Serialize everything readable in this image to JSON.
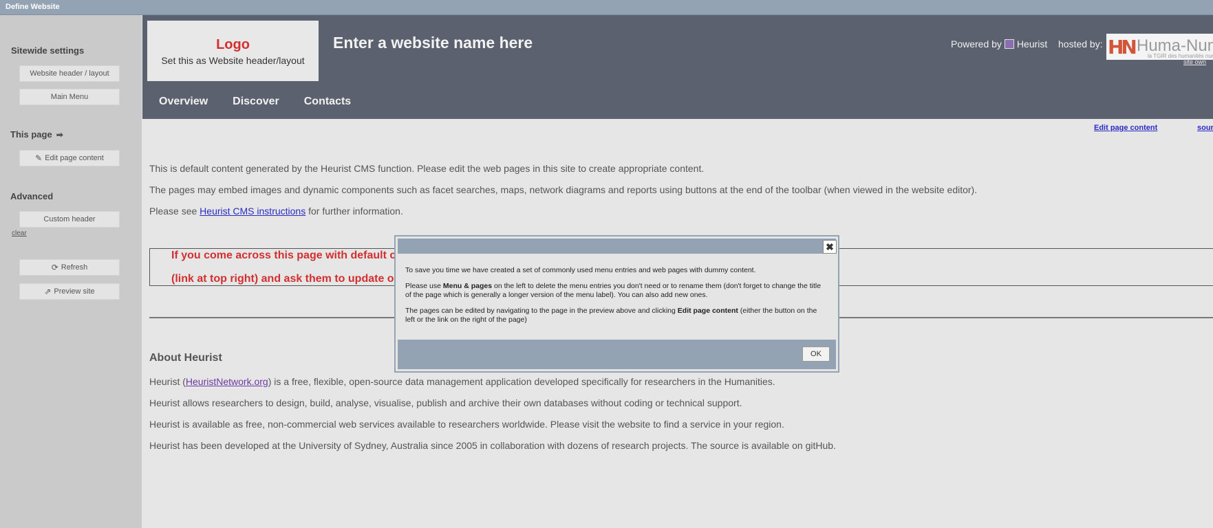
{
  "window": {
    "title": "Define Website"
  },
  "sidebar": {
    "sitewide_heading": "Sitewide settings",
    "header_layout_button": "Website header / layout",
    "main_menu_button": "Main Menu",
    "this_page_heading": "This page",
    "edit_page_button": "Edit page content",
    "advanced_heading": "Advanced",
    "custom_header_button": "Custom header",
    "clear_link": "clear",
    "refresh_button": "Refresh",
    "preview_button": "Preview site"
  },
  "header": {
    "logo_title": "Logo",
    "logo_subtitle": "Set this as Website header/layout",
    "site_name": "Enter a website name here",
    "powered_by": "Powered by",
    "powered_by_name": "Heurist",
    "hosted_by": "hosted by:",
    "host_logo_mark": "HN",
    "host_logo_text": "Huma-Num",
    "host_logo_tagline": "la TGIR des humanités numé",
    "site_owner_link": "site own",
    "nav": [
      "Overview",
      "Discover",
      "Contacts"
    ]
  },
  "page_links": {
    "edit": "Edit page content",
    "source": "sour"
  },
  "content": {
    "p1": "This is default content generated by the Heurist CMS function. Please edit the web pages in this site to create appropriate content.",
    "p2": "The pages may embed images and dynamic components such as facet searches, maps, network diagrams and reports using buttons at the end of the toolbar (when viewed in the website editor).",
    "p3_before": "Please see ",
    "p3_link": "Heurist CMS instructions",
    "p3_after": " for further information.",
    "warning_line1": "If you come across this page with default c",
    "warning_line2": "(link at top right) and ask them to update o",
    "about_heading": "About Heurist",
    "about1_before": "Heurist (",
    "about1_link": "HeuristNetwork.org",
    "about1_after": ") is a free, flexible, open-source data management application developed specifically for researchers in the Humanities.",
    "about2": "Heurist allows researchers to design, build, analyse, visualise, publish and archive their own databases without coding or technical support.",
    "about3": "Heurist is available as free, non-commercial web services available to researchers worldwide. Please visit the website to find a service in your region.",
    "about4": "Heurist has been developed at the University of Sydney, Australia since 2005 in collaboration with dozens of research projects. The source is available on gitHub."
  },
  "dialog": {
    "close_label": "✖",
    "line1": "To save you time we have created a set of commonly used menu entries and web pages with dummy content.",
    "line2_before": "Please use ",
    "line2_bold": "Menu & pages",
    "line2_after": " on the left to delete the menu entries you don't need or to rename them (don't forget to change the title of the page which is generally a longer version of the menu label). You can also add new ones.",
    "line3_before": "The pages can be edited by navigating to the page in the preview above and clicking ",
    "line3_bold": "Edit page content",
    "line3_after": " (either the button on the left or the link on the right of the page)",
    "ok_label": "OK"
  },
  "icons": {
    "arrow": "arrow-right-icon",
    "pencil": "pencil-icon",
    "refresh": "refresh-icon",
    "external": "external-link-icon"
  },
  "colors": {
    "header_bg": "#5b616e",
    "accent_red": "#d32f2f",
    "dialog_bar": "#93a3b3",
    "link": "#2b2bc4"
  }
}
